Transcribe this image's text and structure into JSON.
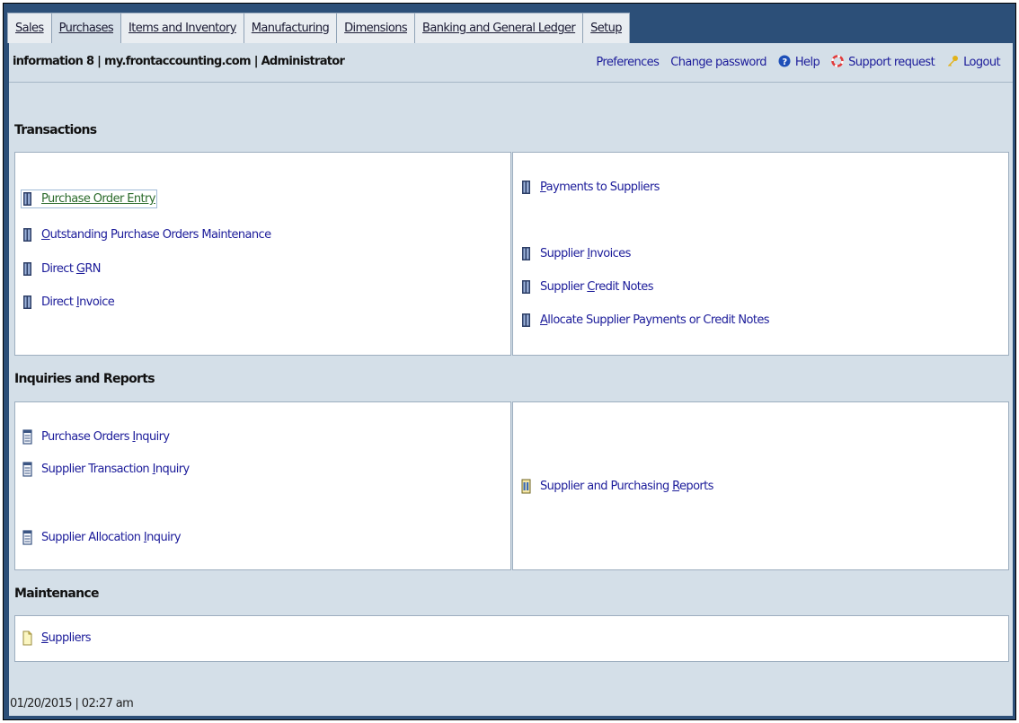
{
  "tabs": [
    {
      "label": "Sales"
    },
    {
      "label": "Purchases"
    },
    {
      "label": "Items and Inventory"
    },
    {
      "label": "Manufacturing"
    },
    {
      "label": "Dimensions"
    },
    {
      "label": "Banking and General Ledger"
    },
    {
      "label": "Setup"
    }
  ],
  "header": {
    "company_info": "information 8 | my.frontaccounting.com | Administrator",
    "preferences": "Preferences",
    "change_password": "Change password",
    "help": "Help",
    "support_request": "Support request",
    "logout": "Logout"
  },
  "sections": {
    "transactions": {
      "title": "Transactions",
      "left": [
        {
          "pre": "",
          "key": "P",
          "post": "urchase Order Entry"
        },
        {
          "pre": "",
          "key": "O",
          "post": "utstanding Purchase Orders Maintenance"
        },
        {
          "pre": "Direct ",
          "key": "G",
          "post": "RN"
        },
        {
          "pre": "Direct ",
          "key": "I",
          "post": "nvoice"
        }
      ],
      "right": [
        {
          "pre": "",
          "key": "P",
          "post": "ayments to Suppliers"
        },
        {
          "pre": "Supplier ",
          "key": "I",
          "post": "nvoices"
        },
        {
          "pre": "Supplier ",
          "key": "C",
          "post": "redit Notes"
        },
        {
          "pre": "",
          "key": "A",
          "post": "llocate Supplier Payments or Credit Notes"
        }
      ]
    },
    "inquiries": {
      "title": "Inquiries and Reports",
      "left": [
        {
          "pre": "Purchase Orders ",
          "key": "I",
          "post": "nquiry"
        },
        {
          "pre": "Supplier Transaction ",
          "key": "I",
          "post": "nquiry"
        },
        {
          "pre": "Supplier Allocation ",
          "key": "I",
          "post": "nquiry"
        }
      ],
      "right": [
        {
          "pre": "Supplier and Purchasing ",
          "key": "R",
          "post": "eports"
        }
      ]
    },
    "maintenance": {
      "title": "Maintenance",
      "left": [
        {
          "pre": "",
          "key": "S",
          "post": "uppliers"
        }
      ]
    }
  },
  "footer": {
    "datetime": "01/20/2015 | 02:27 am"
  },
  "colors": {
    "frame": "#2c4f78",
    "page": "#d4dfe8",
    "link": "#1c1c9a"
  }
}
